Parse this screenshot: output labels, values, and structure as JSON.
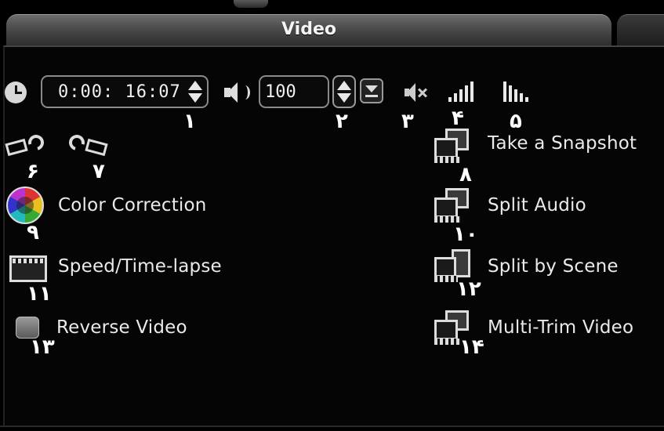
{
  "tabs": {
    "active": "Video"
  },
  "toolbar": {
    "timecode": "0:00: 16:07",
    "volume": "100"
  },
  "actions": {
    "snapshot": "Take a Snapshot",
    "split_audio": "Split Audio",
    "split_scene": "Split by Scene",
    "multi_trim": "Multi-Trim Video",
    "color_correction": "Color Correction",
    "speed": "Speed/Time-lapse",
    "reverse": "Reverse Video"
  },
  "reverse_checked": false,
  "markers": [
    "١",
    "٢",
    "٣",
    "۴",
    "۵",
    "۶",
    "٧",
    "٨",
    "٩",
    "١٠",
    "١١",
    "١٢",
    "١٣",
    "١۴"
  ],
  "icons": [
    "clock-icon",
    "speaker-icon",
    "mute-icon",
    "fade-in-icon",
    "fade-out-icon",
    "rotate-left-icon",
    "rotate-right-icon",
    "snapshot-icon",
    "split-audio-icon",
    "split-scene-icon",
    "multi-trim-icon",
    "color-wheel-icon",
    "speed-icon"
  ],
  "colors": {
    "background": "#000000",
    "text": "#eaeaea",
    "tab": "#4a4a4a"
  }
}
